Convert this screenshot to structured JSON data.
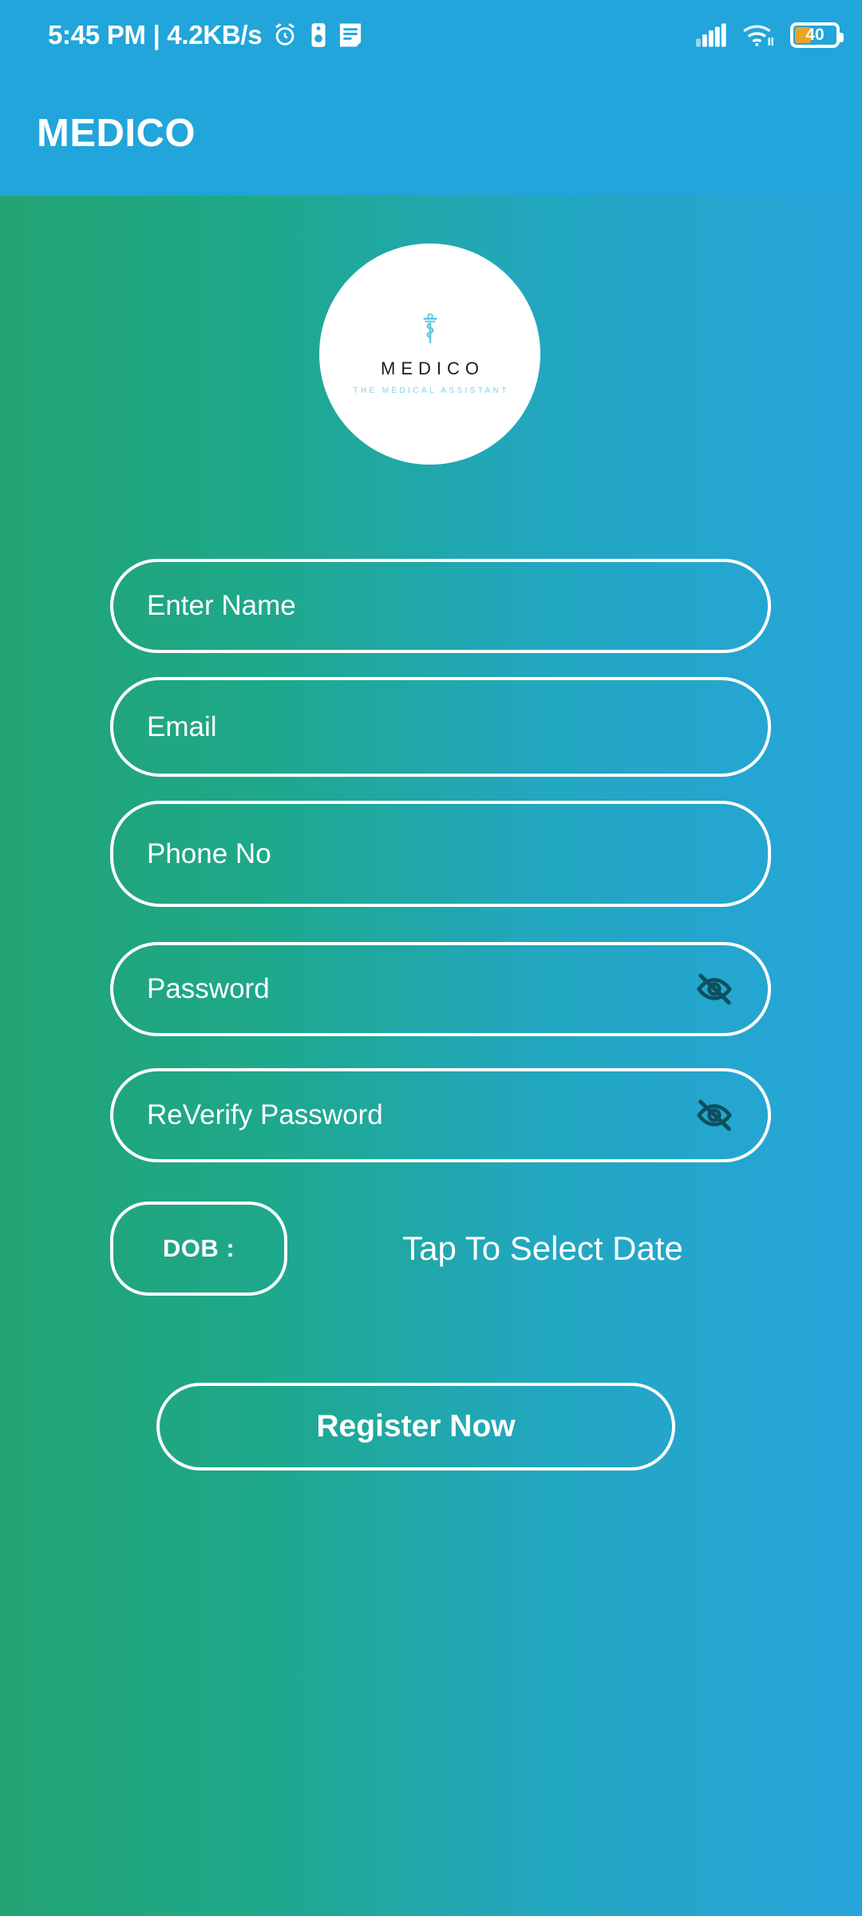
{
  "status_bar": {
    "clock_and_network": "5:45 PM | 4.2KB/s",
    "alarm_icon": "alarm-clock-icon",
    "vibrate_icon": "vibrate-mode-icon",
    "notes_icon": "notes-document-icon",
    "signal_icon": "cellular-signal-icon",
    "wifi_icon": "wifi-icon",
    "battery_icon": "battery-icon",
    "battery_level": "40",
    "battery_percent_value": 40,
    "bar_color": "#21a5da"
  },
  "app_bar": {
    "title": "MEDICO",
    "color": "#21a5da"
  },
  "background": {
    "gradient_start": "#22a373",
    "gradient_end": "#26a5db"
  },
  "logo": {
    "symbol_icon": "caduceus-icon",
    "symbol_color": "#5bc8e0",
    "name": "MEDICO",
    "tagline": "THE MEDICAL ASSISTANT",
    "name_color": "#1d1d1d",
    "tagline_color": "#7fd3e8"
  },
  "form": {
    "fields": [
      {
        "name": "name",
        "label": "Enter Name",
        "value": "",
        "placeholder": "Enter Name",
        "has_eye_toggle": false
      },
      {
        "name": "email",
        "label": "Email",
        "value": "",
        "placeholder": "Email",
        "has_eye_toggle": false
      },
      {
        "name": "phone",
        "label": "Phone No",
        "value": "",
        "placeholder": "Phone No",
        "has_eye_toggle": false
      },
      {
        "name": "password",
        "label": "Password",
        "value": "",
        "placeholder": "Password",
        "has_eye_toggle": true,
        "eye_icon": "eye-off-icon"
      },
      {
        "name": "reverify_password",
        "label": "ReVerify Password",
        "value": "",
        "placeholder": "ReVerify Password",
        "has_eye_toggle": true,
        "eye_icon": "eye-off-icon"
      }
    ],
    "dob": {
      "label": "DOB :",
      "value": "Tap To Select Date"
    },
    "submit": {
      "label": "Register Now"
    },
    "accent_border": "#ffffff",
    "eye_icon_color": "#0d4f5c"
  }
}
